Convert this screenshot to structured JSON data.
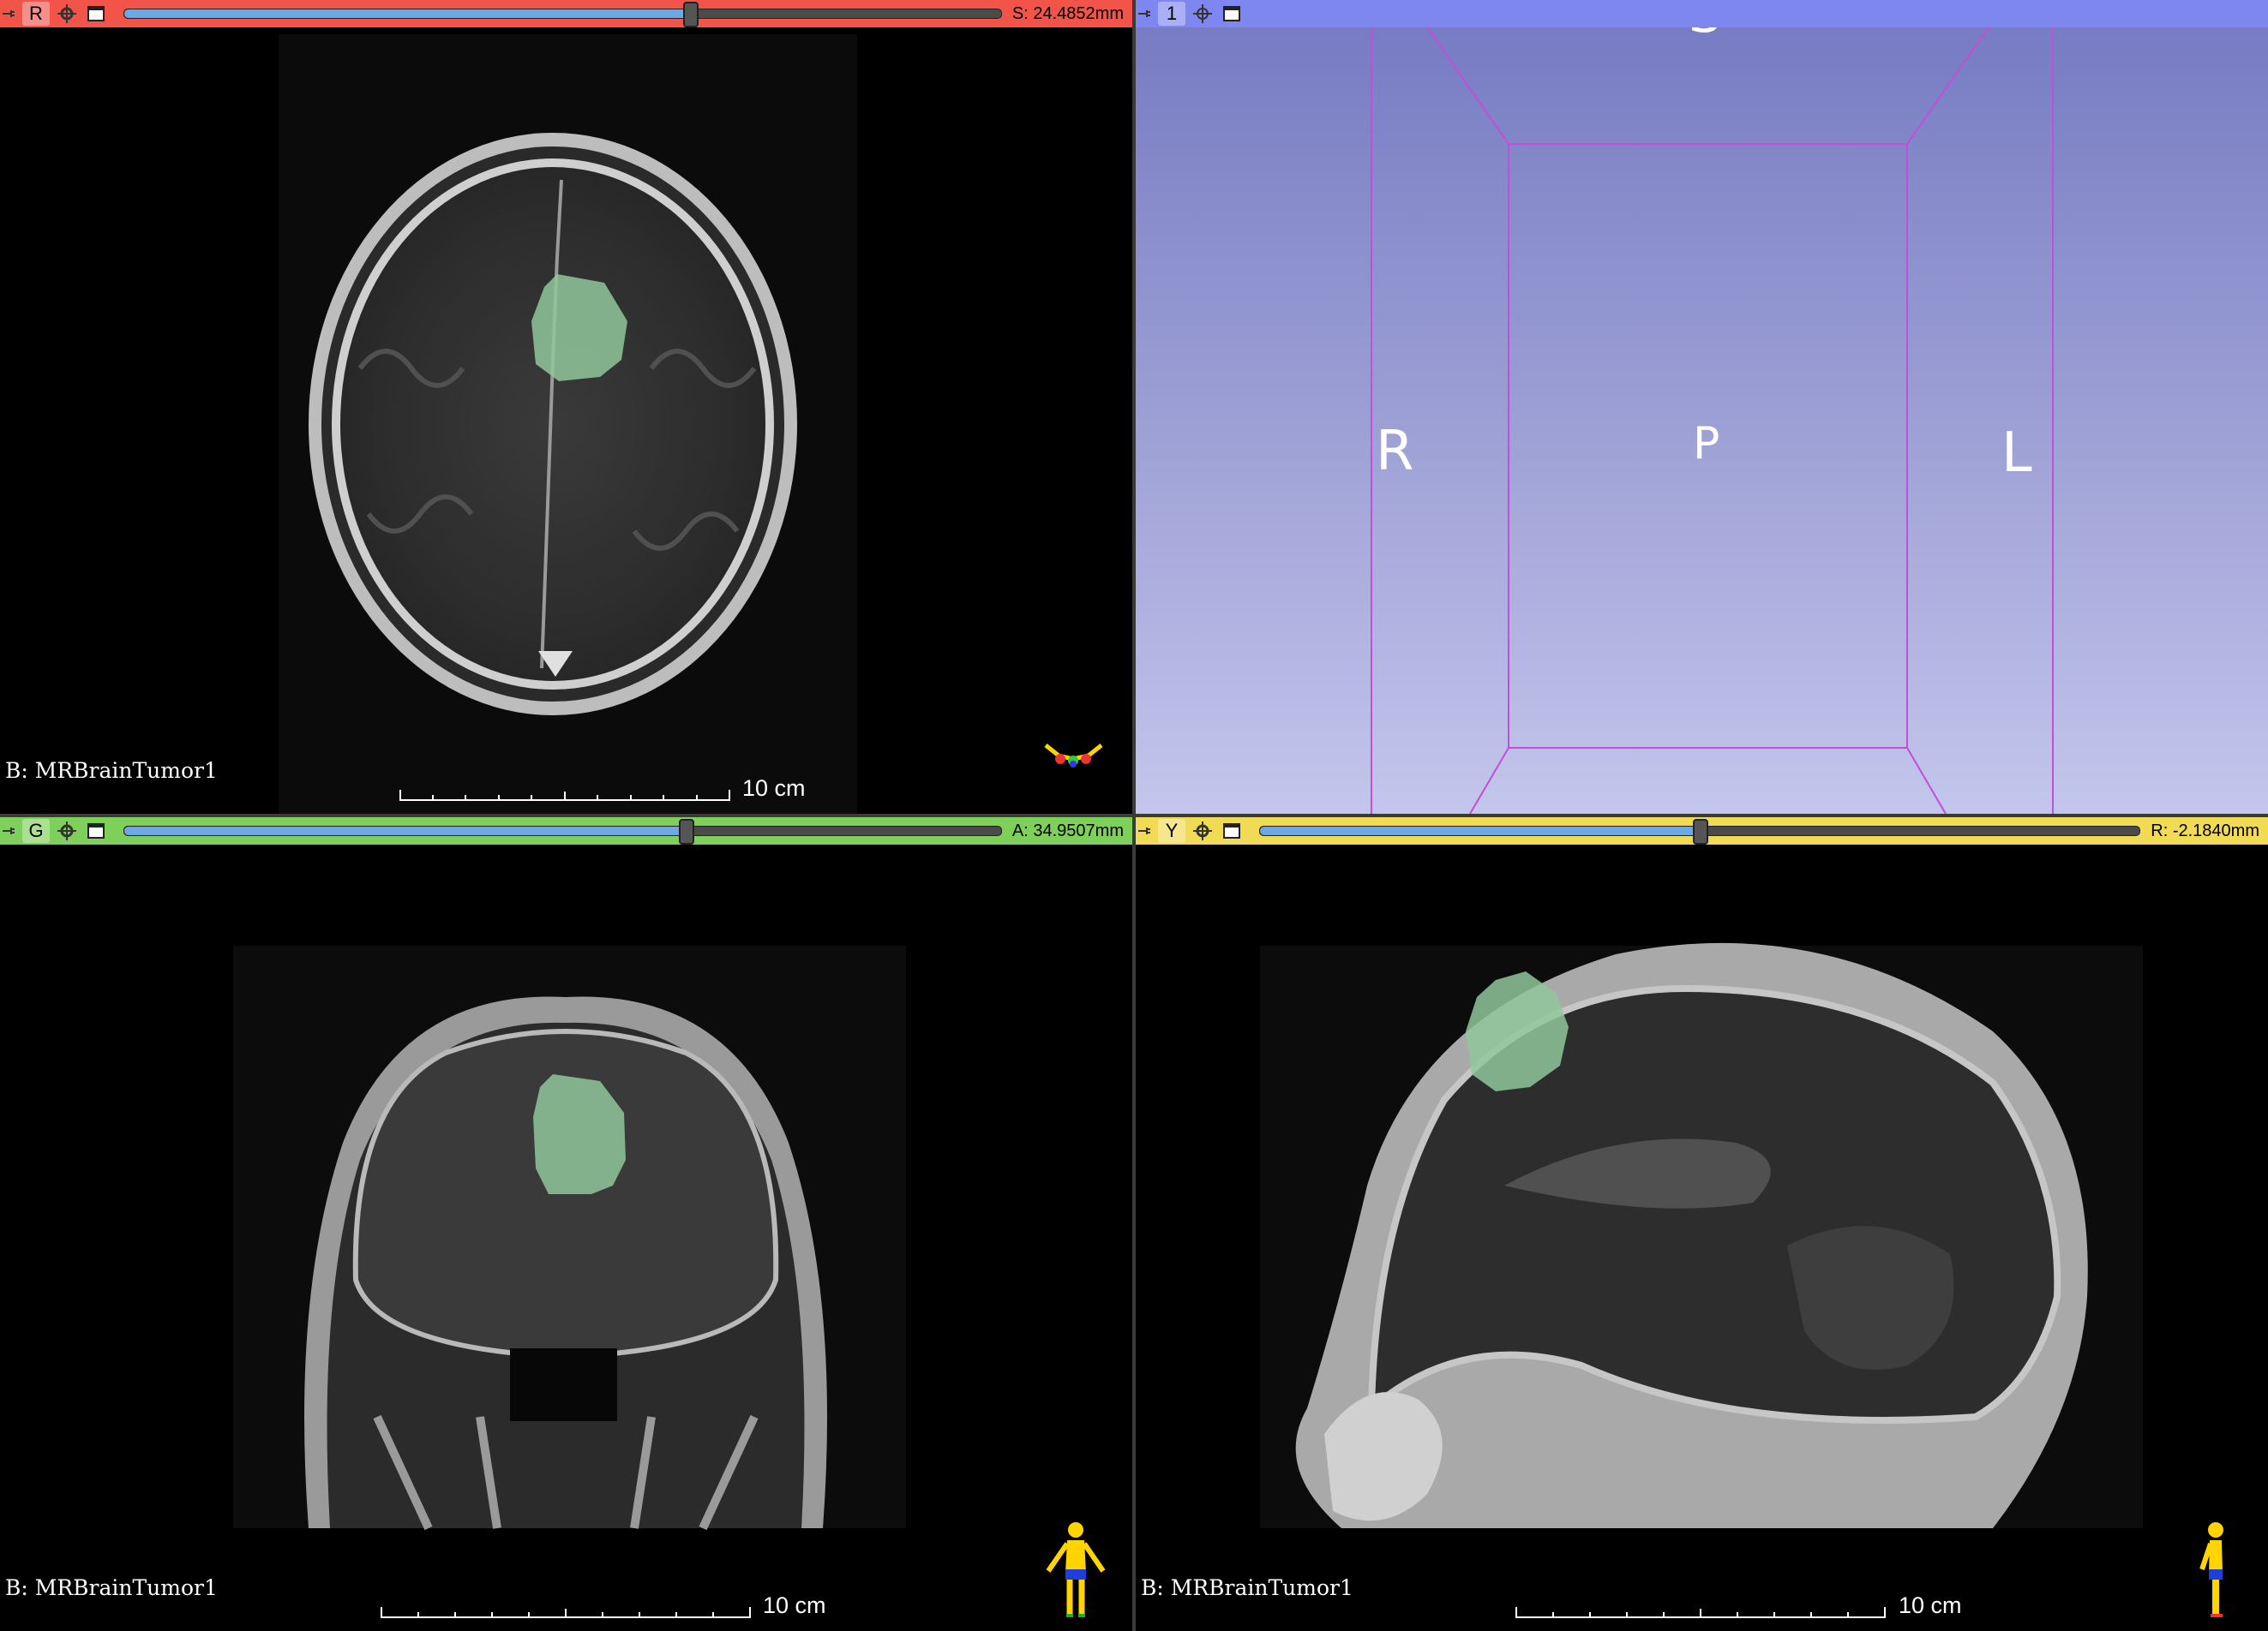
{
  "views": {
    "red": {
      "label": "R",
      "offset": "S: 24.4852mm",
      "slider_fraction": 0.645,
      "bg": "B: MRBrainTumor1",
      "scale": "10 cm",
      "color": "#f2544a"
    },
    "threed": {
      "label": "1",
      "color": "#7e86f0",
      "orientation": {
        "top": "S",
        "left": "R",
        "center": "P",
        "right": "L"
      }
    },
    "green": {
      "label": "G",
      "offset": "A: 34.9507mm",
      "slider_fraction": 0.64,
      "bg": "B: MRBrainTumor1",
      "scale": "10 cm",
      "color": "#7ed05a"
    },
    "yellow": {
      "label": "Y",
      "offset": "R: -2.1840mm",
      "slider_fraction": 0.5,
      "bg": "B: MRBrainTumor1",
      "scale": "10 cm",
      "color": "#f1da54"
    }
  },
  "icons": [
    "pin-icon",
    "link-icon",
    "maximize-view-icon",
    "center-3d-icon",
    "orientation-marker-icon"
  ],
  "segment_color": "#8fc79a"
}
